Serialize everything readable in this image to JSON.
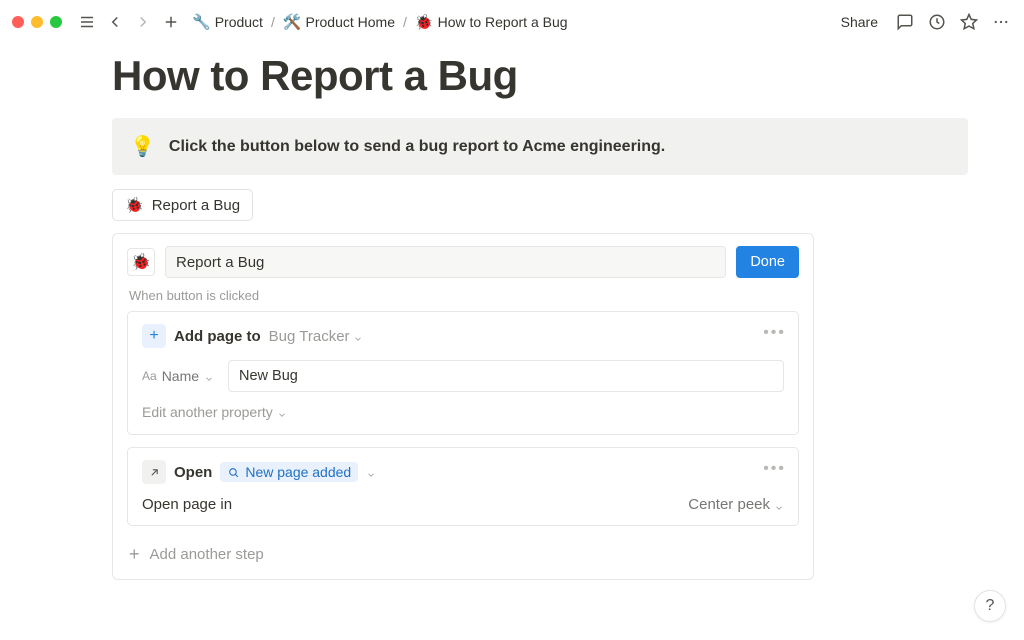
{
  "topbar": {
    "breadcrumbs": [
      {
        "emoji": "🔧",
        "label": "Product"
      },
      {
        "emoji": "🛠️",
        "label": "Product Home"
      },
      {
        "emoji": "🐞",
        "label": "How to Report a Bug"
      }
    ],
    "share_label": "Share"
  },
  "page": {
    "title": "How to Report a Bug",
    "callout": {
      "emoji": "💡",
      "text": "Click the button below to send a bug report to Acme engineering."
    }
  },
  "button_block": {
    "emoji": "🐞",
    "label": "Report a Bug"
  },
  "config": {
    "button_emoji": "🐞",
    "button_name": "Report a Bug",
    "done_label": "Done",
    "when_label": "When button is clicked",
    "steps": [
      {
        "kind": "add_page",
        "verb": "Add page to",
        "target": "Bug Tracker",
        "prop_name_label": "Name",
        "prop_name_value": "New Bug",
        "edit_prop_label": "Edit another property"
      },
      {
        "kind": "open",
        "verb": "Open",
        "token": "New page added",
        "open_in_label": "Open page in",
        "open_in_value": "Center peek"
      }
    ],
    "add_step_label": "Add another step"
  },
  "help_label": "?"
}
